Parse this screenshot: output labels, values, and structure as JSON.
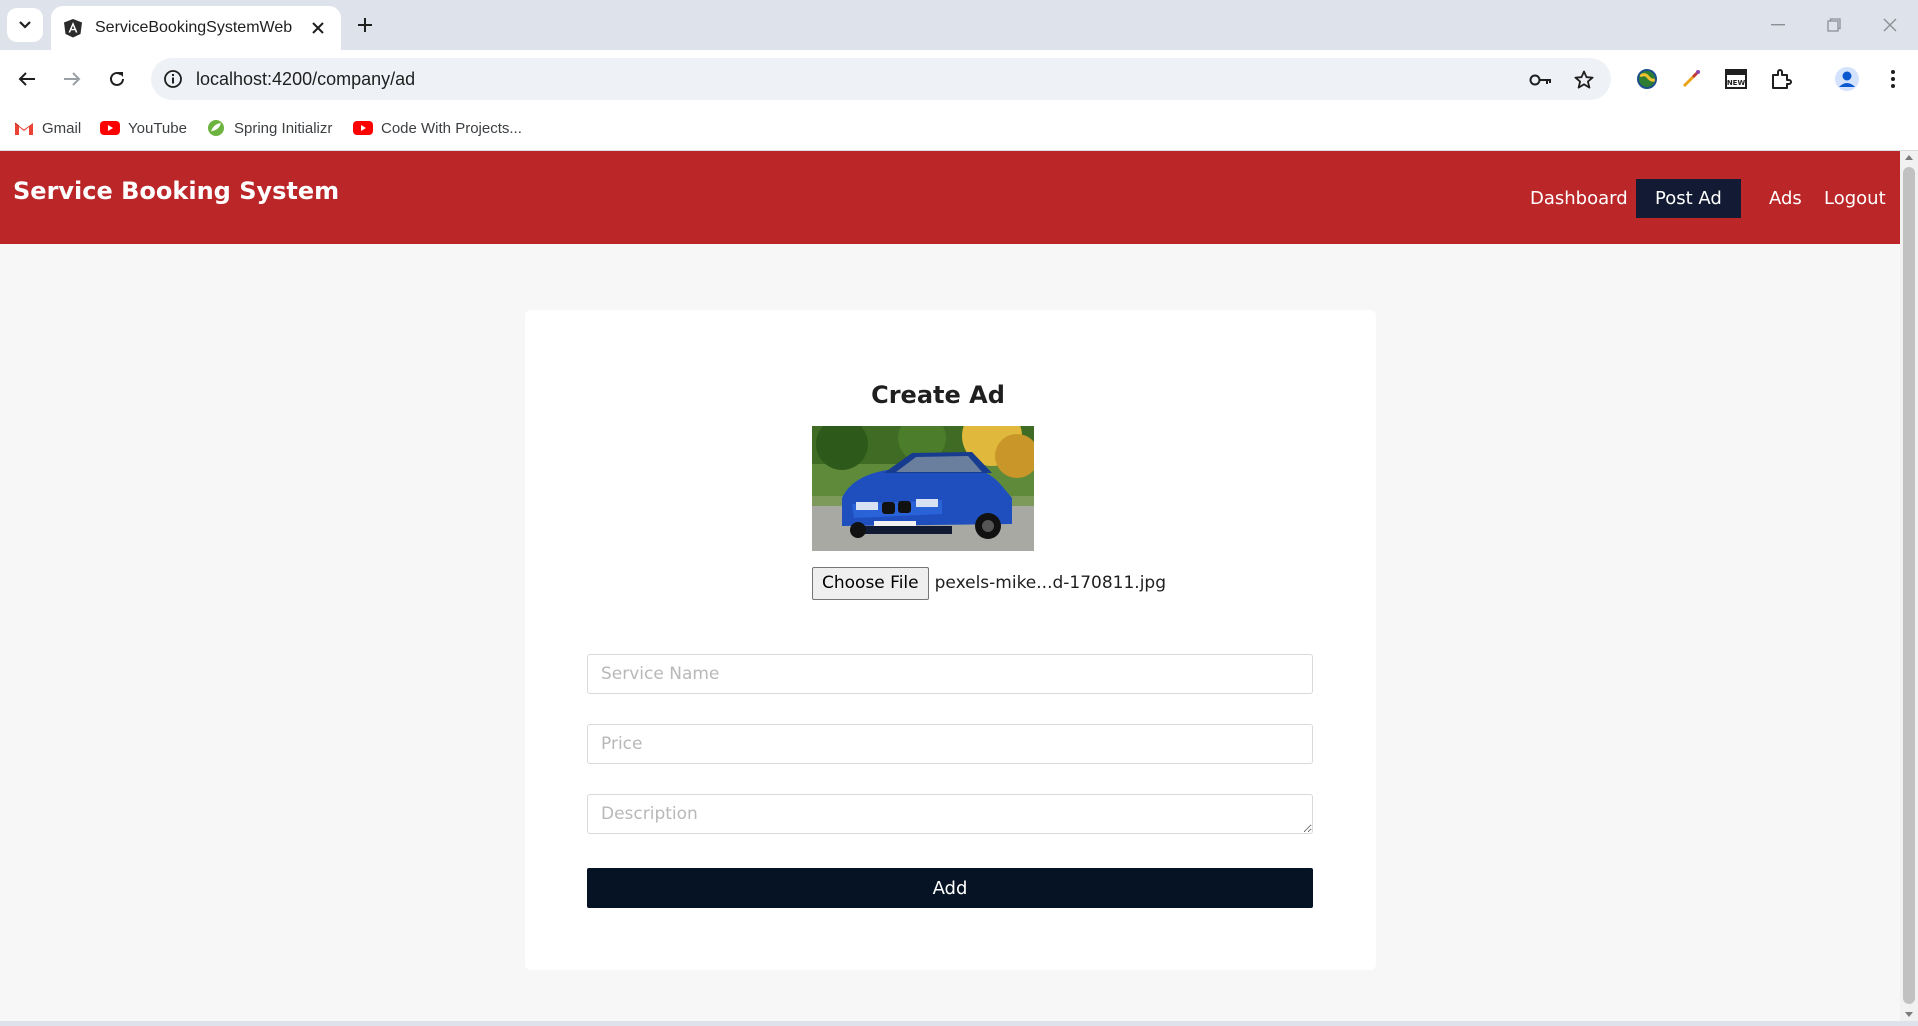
{
  "browser": {
    "tab_title": "ServiceBookingSystemWeb",
    "url": "localhost:4200/company/ad",
    "bookmarks": [
      {
        "label": "Gmail",
        "icon": "gmail-icon"
      },
      {
        "label": "YouTube",
        "icon": "youtube-icon"
      },
      {
        "label": "Spring Initializr",
        "icon": "spring-icon"
      },
      {
        "label": "Code With Projects...",
        "icon": "youtube-icon"
      }
    ],
    "colors": {
      "chrome": "#dee3eb",
      "omnibox": "#eef1f6"
    }
  },
  "app": {
    "brand": "Service Booking System",
    "nav": [
      {
        "label": "Dashboard",
        "active": false
      },
      {
        "label": "Post Ad",
        "active": true
      },
      {
        "label": "Ads",
        "active": false
      },
      {
        "label": "Logout",
        "active": false
      }
    ],
    "colors": {
      "navbar": "#bb2629",
      "active_nav": "#131a33",
      "button": "#061325"
    }
  },
  "form": {
    "title": "Create Ad",
    "image_alt": "blue car",
    "choose_file_label": "Choose File",
    "file_name": "pexels-mike...d-170811.jpg",
    "service_name": {
      "placeholder": "Service Name",
      "value": ""
    },
    "price": {
      "placeholder": "Price",
      "value": ""
    },
    "description": {
      "placeholder": "Description",
      "value": ""
    },
    "submit_label": "Add"
  }
}
